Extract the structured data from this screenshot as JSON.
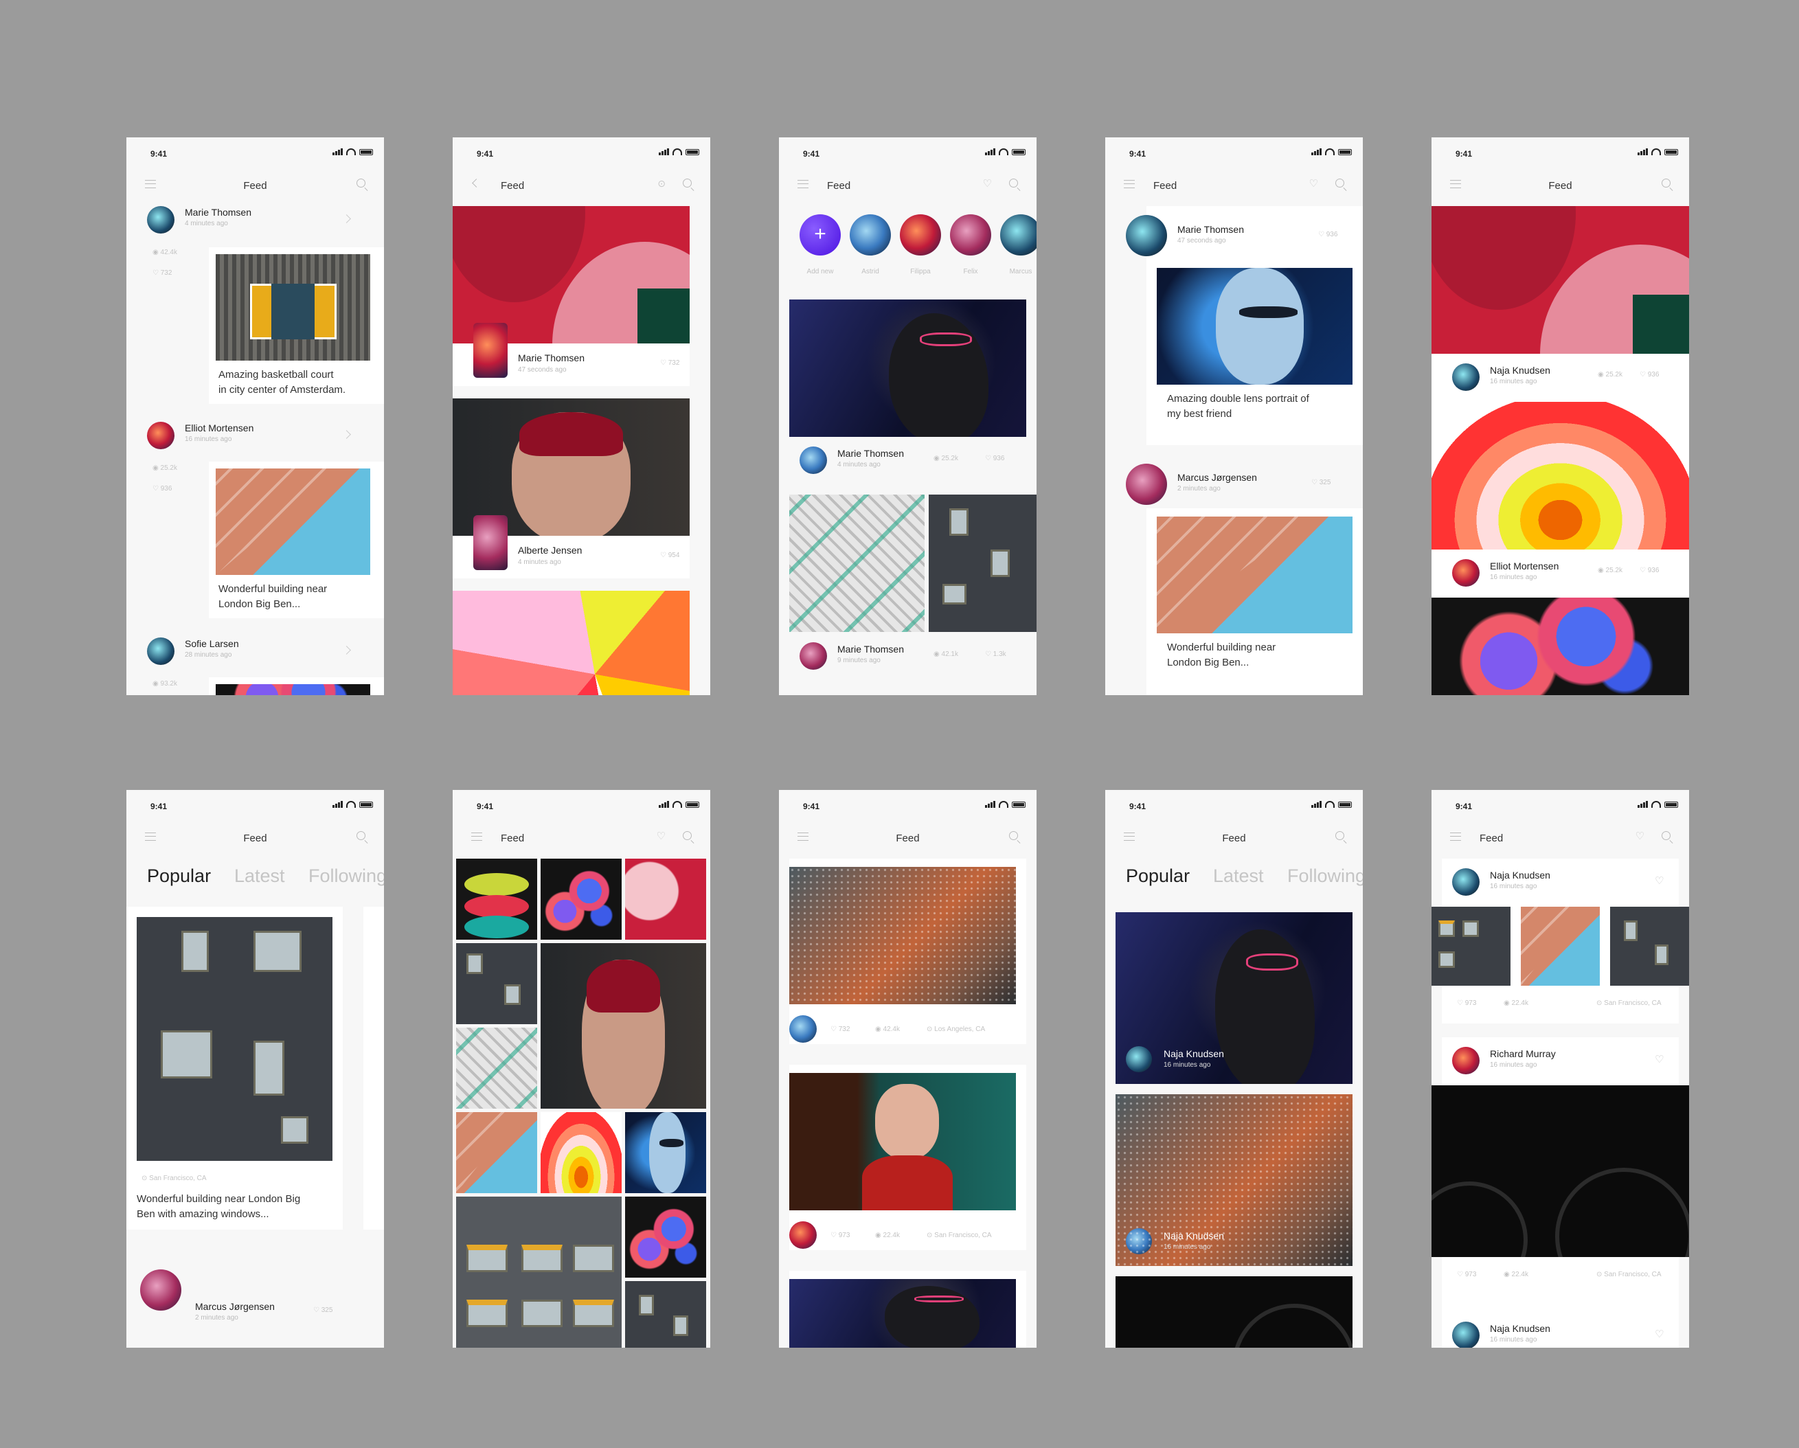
{
  "status": {
    "time": "9:41"
  },
  "colors": {
    "background": "#9b9b9b",
    "accent": "#5a1ff0",
    "screen": "#f7f7f7"
  },
  "icons": [
    "menu-icon",
    "search-icon",
    "back-icon",
    "heart-icon",
    "location-pin-icon",
    "eye-icon",
    "chevron-right-icon",
    "plus-icon"
  ],
  "s1": {
    "title": "Feed",
    "posts": [
      {
        "name": "Marie Thomsen",
        "time": "4 minutes ago",
        "views": "42.4k",
        "likes": "732",
        "caption1": "Amazing basketball court",
        "caption2": "in city center of Amsterdam."
      },
      {
        "name": "Elliot Mortensen",
        "time": "16 minutes ago",
        "views": "25.2k",
        "likes": "936",
        "caption1": "Wonderful building near",
        "caption2": "London Big Ben..."
      },
      {
        "name": "Sofie Larsen",
        "time": "28 minutes ago",
        "views": "93.2k"
      }
    ]
  },
  "s2": {
    "title": "Feed",
    "posts": [
      {
        "name": "Marie Thomsen",
        "time": "47 seconds ago",
        "likes": "732"
      },
      {
        "name": "Alberte Jensen",
        "time": "4 minutes ago",
        "likes": "954"
      }
    ]
  },
  "s3": {
    "title": "Feed",
    "stories": [
      "Add new",
      "Astrid",
      "Filippa",
      "Felix",
      "Marcus"
    ],
    "posts": [
      {
        "name": "Marie Thomsen",
        "time": "4 minutes ago",
        "views": "25.2k",
        "likes": "936"
      },
      {
        "name": "Marie Thomsen",
        "time": "9 minutes ago",
        "views": "42.1k",
        "likes": "1.3k"
      }
    ]
  },
  "s4": {
    "title": "Feed",
    "posts": [
      {
        "name": "Marie Thomsen",
        "time": "47 seconds ago",
        "likes": "936",
        "caption1": "Amazing double lens portrait of",
        "caption2": "my best friend"
      },
      {
        "name": "Marcus Jørgensen",
        "time": "2 minutes ago",
        "likes": "325",
        "caption1": "Wonderful building near",
        "caption2": "London Big Ben..."
      }
    ]
  },
  "s5": {
    "title": "Feed",
    "posts": [
      {
        "name": "Naja Knudsen",
        "time": "16 minutes ago",
        "views": "25.2k",
        "likes": "936"
      },
      {
        "name": "Elliot Mortensen",
        "time": "16 minutes ago",
        "views": "25.2k",
        "likes": "936"
      }
    ]
  },
  "s6": {
    "title": "Feed",
    "tabs": [
      "Popular",
      "Latest",
      "Following"
    ],
    "location": "San Francisco, CA",
    "caption1": "Wonderful building near London Big",
    "caption2": "Ben with amazing windows...",
    "name": "Marcus Jørgensen",
    "time": "2 minutes ago",
    "likes": "325"
  },
  "s7": {
    "title": "Feed"
  },
  "s8": {
    "title": "Feed",
    "posts": [
      {
        "likes": "732",
        "views": "42.4k",
        "location": "Los Angeles, CA"
      },
      {
        "likes": "973",
        "views": "22.4k",
        "location": "San Francisco, CA"
      }
    ]
  },
  "s9": {
    "title": "Feed",
    "tabs": [
      "Popular",
      "Latest",
      "Following"
    ],
    "posts": [
      {
        "name": "Naja Knudsen",
        "time": "16 minutes ago"
      },
      {
        "name": "Naja Knudsen",
        "time": "16 minutes ago"
      }
    ]
  },
  "s10": {
    "title": "Feed",
    "posts": [
      {
        "name": "Naja Knudsen",
        "time": "16 minutes ago",
        "likes": "973",
        "views": "22.4k",
        "location": "San Francisco, CA"
      },
      {
        "name": "Richard Murray",
        "time": "16 minutes ago",
        "likes": "973",
        "views": "22.4k",
        "location": "San Francisco, CA"
      },
      {
        "name": "Naja Knudsen",
        "time": "16 minutes ago"
      }
    ]
  }
}
